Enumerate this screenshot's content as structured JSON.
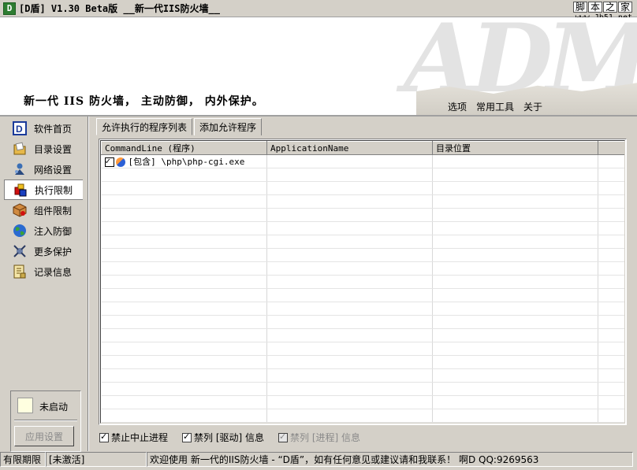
{
  "window": {
    "icon_letter": "D",
    "title": "[D盾] V1.30 Beta版  __新一代IIS防火墙__",
    "watermark_chars": [
      "脚",
      "本",
      "之",
      "家"
    ],
    "watermark_url": "www.Jb51.net"
  },
  "banner": {
    "logo_text": "ADM",
    "slogan": "新一代 IIS 防火墙， 主动防御， 内外保护。",
    "menu": [
      "选项",
      "常用工具",
      "关于"
    ]
  },
  "sidebar": {
    "items": [
      {
        "label": "软件首页",
        "icon": "d-logo-icon",
        "color": "#1a3a9a"
      },
      {
        "label": "目录设置",
        "icon": "folder-icon",
        "color": "#e6b84a"
      },
      {
        "label": "网络设置",
        "icon": "network-icon",
        "color": "#3b6fb5"
      },
      {
        "label": "执行限制",
        "icon": "blocks-icon",
        "color": "#d01010"
      },
      {
        "label": "组件限制",
        "icon": "package-icon",
        "color": "#c07a30"
      },
      {
        "label": "注入防御",
        "icon": "globe-icon",
        "color": "#2e8b3d"
      },
      {
        "label": "更多保护",
        "icon": "satellite-icon",
        "color": "#6a7ea8"
      },
      {
        "label": "记录信息",
        "icon": "log-icon",
        "color": "#c9a94a"
      }
    ],
    "active_index": 3,
    "status_label": "未启动",
    "apply_button": "应用设置"
  },
  "tabs": [
    {
      "label": "允许执行的程序列表",
      "active": true
    },
    {
      "label": "添加允许程序",
      "active": false
    }
  ],
  "grid": {
    "columns": [
      "CommandLine (程序)",
      "ApplicationName",
      "目录位置"
    ],
    "rows": [
      {
        "checked": true,
        "commandline": "[包含] \\php\\php-cgi.exe",
        "application": "",
        "location": ""
      }
    ],
    "empty_rows": 19
  },
  "options": [
    {
      "label": "禁止中止进程",
      "checked": true,
      "enabled": true
    },
    {
      "label": "禁列 [驱动] 信息",
      "checked": true,
      "enabled": true
    },
    {
      "label": "禁列 [进程] 信息",
      "checked": true,
      "enabled": false
    }
  ],
  "statusbar": {
    "license_label": "有限期限",
    "license_value": "[未激活]",
    "message": "欢迎使用 新一代的IIS防火墙 - “D盾”，如有任何意见或建议请和我联系！ 啊D  QQ:9269563"
  }
}
